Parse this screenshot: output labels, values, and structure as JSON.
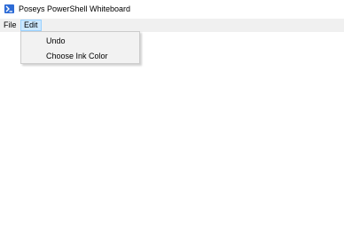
{
  "window": {
    "title": "Poseys PowerShell Whiteboard",
    "icon": "powershell-icon"
  },
  "menubar": {
    "items": [
      {
        "label": "File",
        "active": false
      },
      {
        "label": "Edit",
        "active": true
      }
    ]
  },
  "edit_menu": {
    "items": [
      {
        "label": "Undo"
      },
      {
        "label": "Choose Ink Color"
      }
    ]
  },
  "colors": {
    "menu_highlight": "#cce8ff",
    "menu_highlight_border": "#99d1ff",
    "icon_blue": "#2d6bd6"
  }
}
